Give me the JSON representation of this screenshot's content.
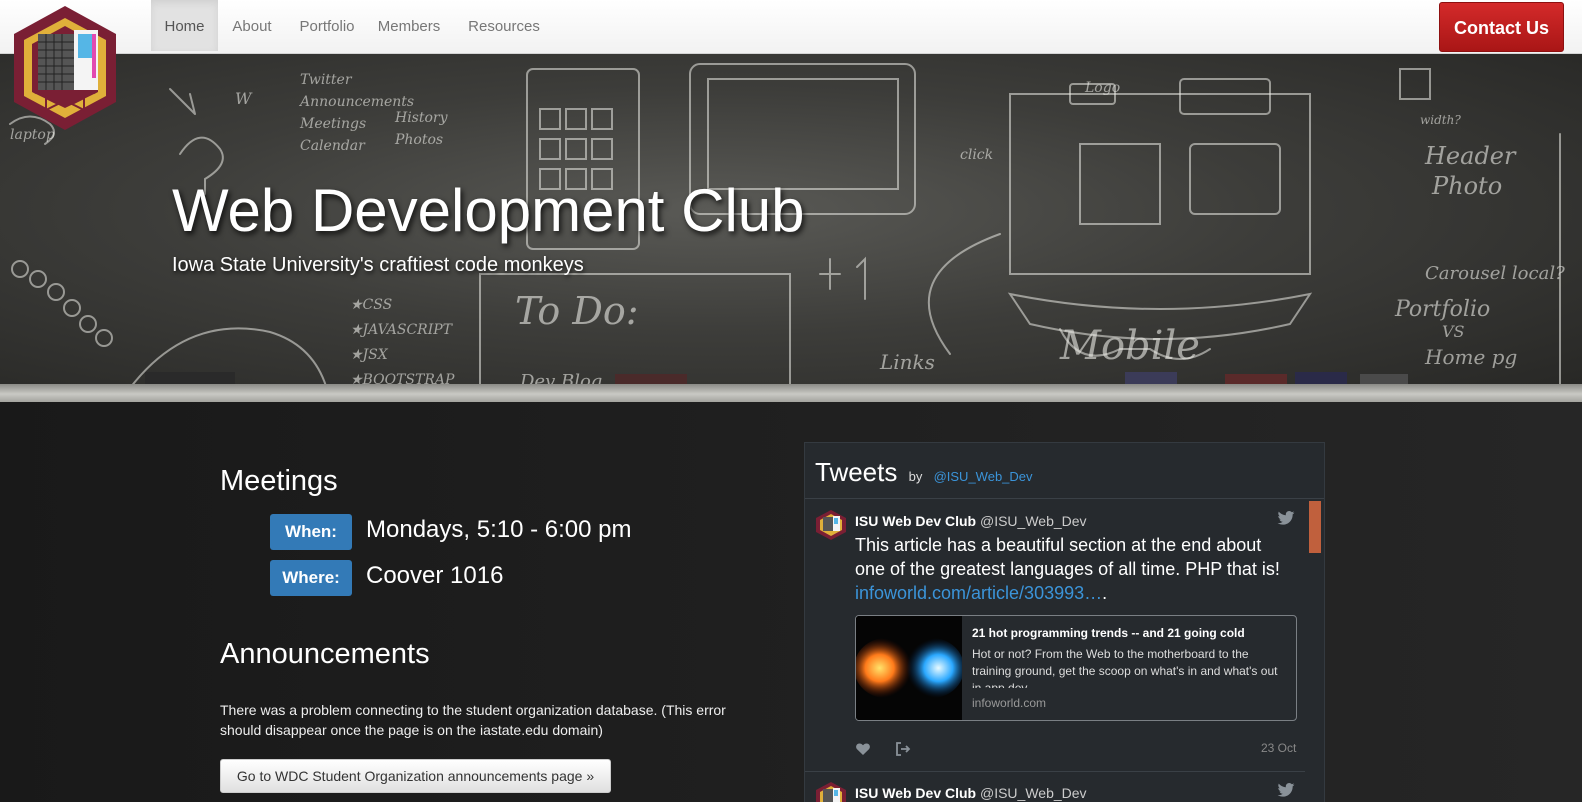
{
  "nav": {
    "items": [
      {
        "label": "Home",
        "active": true
      },
      {
        "label": "About"
      },
      {
        "label": "Portfolio"
      },
      {
        "label": "Members"
      },
      {
        "label": "Resources"
      }
    ],
    "contact_label": "Contact Us"
  },
  "hero": {
    "title": "Web Development Club",
    "subtitle": "Iowa State University's craftiest code monkeys"
  },
  "meetings": {
    "heading": "Meetings",
    "when_label": "When:",
    "when_value": "Mondays, 5:10 - 6:00 pm",
    "where_label": "Where:",
    "where_value": "Coover 1016"
  },
  "announcements": {
    "heading": "Announcements",
    "message": "There was a problem connecting to the student organization database. (This error should disappear once the page is on the iastate.edu domain)",
    "button_label": "Go to WDC Student Organization announcements page »"
  },
  "tweets": {
    "heading": "Tweets",
    "by": "by",
    "by_handle": "@ISU_Web_Dev",
    "items": [
      {
        "name": "ISU Web Dev Club",
        "handle": "@ISU_Web_Dev",
        "text": "This article has a beautiful section at the end about one of the greatest languages of all time. PHP that is!",
        "link": "infoworld.com/article/303993…",
        "link_suffix": ".",
        "card_title": "21 hot programming trends -- and 21 going cold",
        "card_desc": "Hot or not? From the Web to the motherboard to the training ground, get the scoop on what's in and what's out in app dev",
        "card_domain": "infoworld.com",
        "date": "23 Oct"
      },
      {
        "name": "ISU Web Dev Club",
        "handle": "@ISU_Web_Dev"
      }
    ]
  },
  "colors": {
    "accent_blue": "#337ab7",
    "contact_red": "#c62828",
    "twitter_link": "#3b94d9"
  }
}
